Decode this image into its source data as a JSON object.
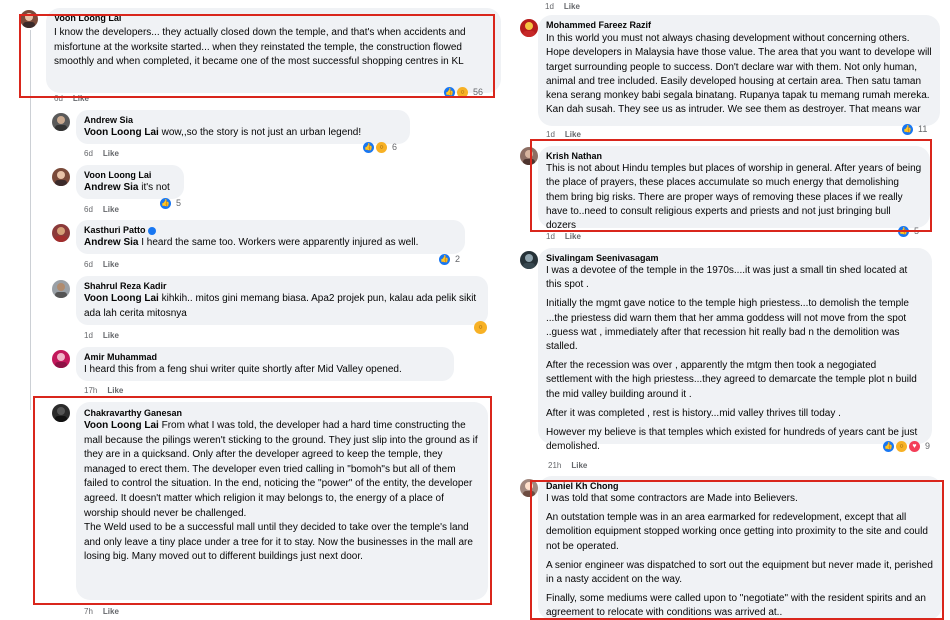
{
  "left": {
    "c1": {
      "author": "Voon Loong Lai",
      "text": "I know the developers... they actually closed down the temple, and that's when accidents and misfortune at the worksite started... when they reinstated the temple, the construction flowed smoothly and when completed, it became one of the most successful shopping centres in KL",
      "time": "6d",
      "like": "Like",
      "reactions": "56"
    },
    "c2": {
      "author": "Andrew Sia",
      "mention": "Voon Loong Lai",
      "text": " wow,,so the story is not just an urban legend!",
      "time": "6d",
      "like": "Like",
      "reactions": "6"
    },
    "c3": {
      "author": "Voon Loong Lai",
      "mention": "Andrew Sia",
      "text": " it's not",
      "time": "6d",
      "like": "Like",
      "reactions": "5"
    },
    "c4": {
      "author": "Kasthuri Patto",
      "mention": "Andrew Sia",
      "text": " I heard the same too. Workers were apparently injured as well.",
      "time": "6d",
      "like": "Like",
      "reactions": "2"
    },
    "c5": {
      "author": "Shahrul Reza Kadir",
      "mention": "Voon Loong Lai",
      "text": " kihkih.. mitos gini memang biasa. Apa2 projek pun, kalau ada pelik sikit ada lah cerita mitosnya",
      "time": "1d",
      "like": "Like"
    },
    "c6": {
      "author": "Amir Muhammad",
      "text": "I heard this from a feng shui writer quite shortly after Mid Valley opened.",
      "time": "17h",
      "like": "Like"
    },
    "c7": {
      "author": "Chakravarthy Ganesan",
      "mention": "Voon Loong Lai",
      "text": " From what I was told, the developer had a hard time constructing the mall because the pilings weren't sticking to the ground. They just slip into the ground as if they are in a quicksand. Only after the developer agreed to keep the temple, they managed to erect them. The developer even tried calling in \"bomoh\"s but all of them failed to control the situation. In the end, noticing the \"power\" of the entity, the developer agreed. It doesn't matter which religion it may belongs to, the energy of a place of worship should never be challenged.",
      "text2": "The Weld used to be a successful mall until they decided to take over the temple's land and only leave a tiny place under a tree for it to stay. Now the businesses in the mall are losing big. Many moved out to different buildings just next door.",
      "time": "7h",
      "like": "Like"
    }
  },
  "right": {
    "top": {
      "time": "1d",
      "like": "Like"
    },
    "c1": {
      "author": "Mohammed Fareez Razif",
      "text": "In this world you must not always chasing development without concerning others. Hope developers in Malaysia have those value. The area that you want to develope will target surrounding people to success. Don't declare war with them. Not only human, animal and tree included. Easily developed housing at certain area. Then satu taman kena serang monkey babi segala binatang. Rupanya tapak tu memang rumah mereka. Kan dah susah. They see us as intruder. We see them as destroyer. That means war",
      "time": "1d",
      "like": "Like",
      "reactions": "11"
    },
    "c2": {
      "author": "Krish Nathan",
      "text": "This is not about Hindu temples but places of worship in general. After years of being the place of prayers, these places accumulate so much energy that demolishing them bring big risks. There are proper ways of removing these places if we really have to..need to consult religious experts and priests and not just bringing bull dozers",
      "time": "1d",
      "like": "Like",
      "reactions": "5"
    },
    "c3": {
      "author": "Sivalingam Seenivasagam",
      "p1": "I was a devotee of the temple in the 1970s....it was just a small tin shed located at this spot .",
      "p2": "Initially the mgmt gave notice to the temple high priestess...to demolish the temple ...the priestess did warn them that her amma goddess will not move from the spot ..guess wat , immediately after that recession hit really bad n the demolition was stalled.",
      "p3": "After the recession was over , apparently the mtgm then took a negogiated settlement with the high priestess...they agreed to demarcate the temple plot n build the mid valley building around it .",
      "p4": "After it was completed , rest is history...mid valley thrives till today .",
      "p5": "However my believe is that temples which existed for hundreds of years cant be just demolished.",
      "time": "21h",
      "like": "Like",
      "reactions": "9"
    },
    "c4": {
      "author": "Daniel Kh Chong",
      "p1": "I was told that some contractors are Made into Believers.",
      "p2": "An outstation temple was in an area earmarked for redevelopment, except that all demolition equipment stopped working once getting into proximity to the site and could not be operated.",
      "p3": "A senior engineer was dispatched to sort out the equipment but never made it, perished in a nasty accident on the way.",
      "p4": "Finally, some mediums were called upon to \"negotiate\" with the resident spirits and an agreement to relocate with conditions was arrived at.."
    }
  },
  "colors": {
    "highlight": "#d9261c",
    "bubble": "#f0f2f5",
    "like_blue": "#1877f2"
  }
}
